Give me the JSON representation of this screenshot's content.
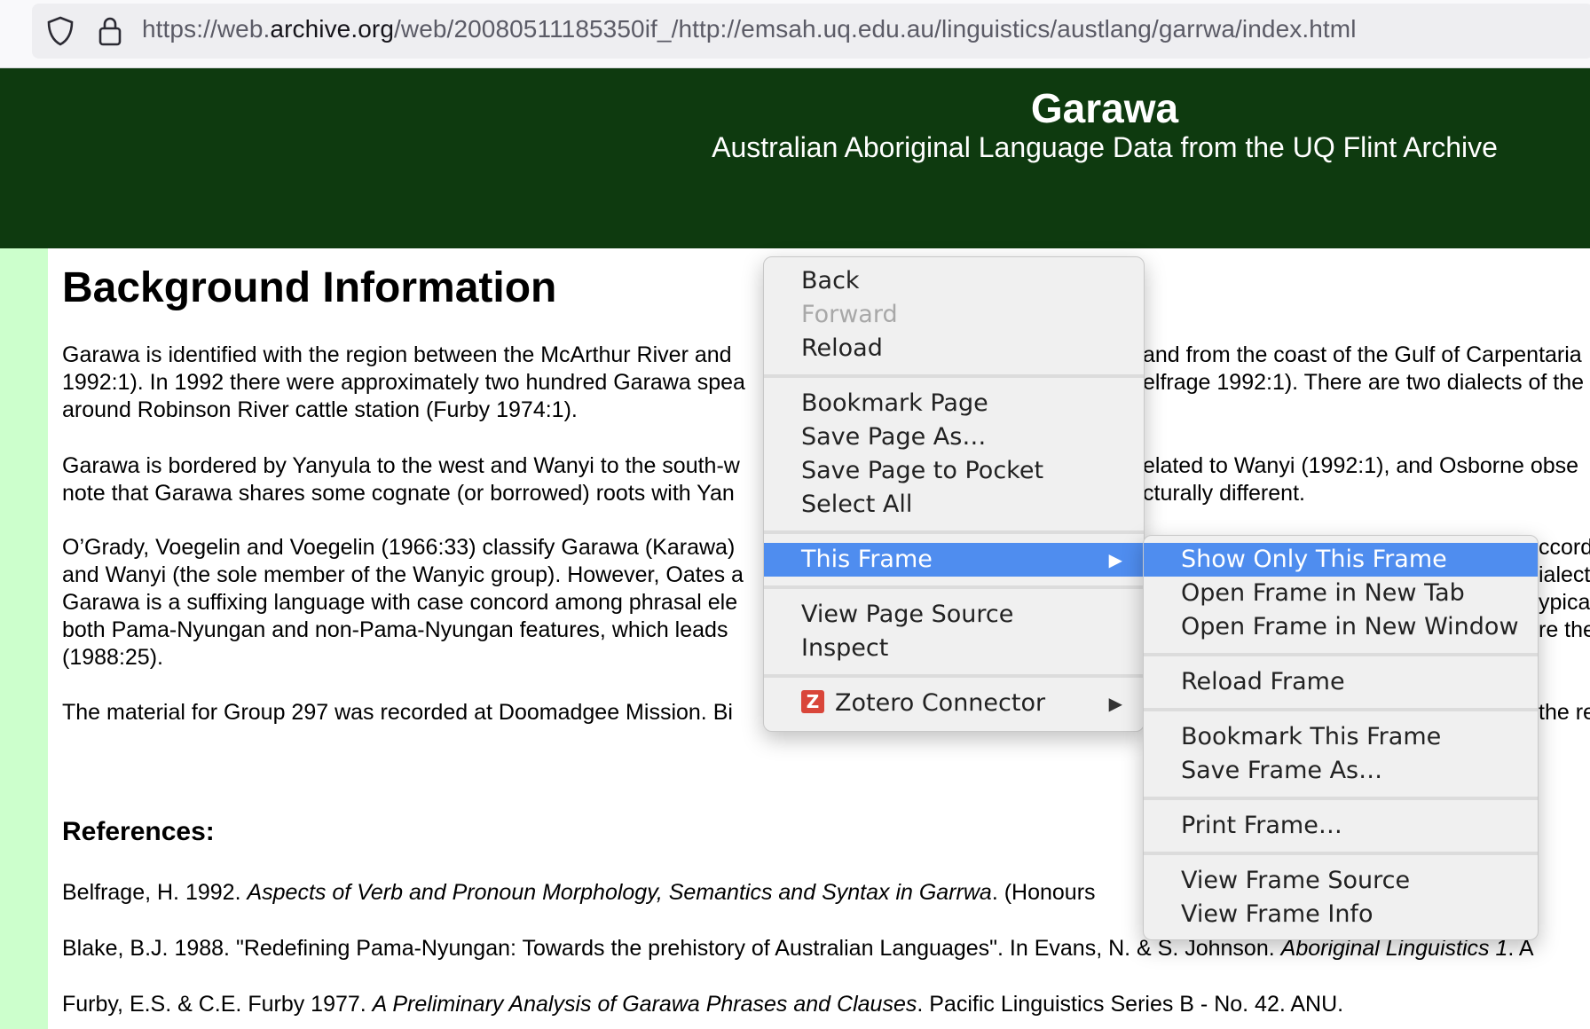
{
  "browser": {
    "url_prefix": "https://web.",
    "url_domain": "archive.org",
    "url_rest": "/web/20080511185350if_/http://emsah.uq.edu.au/linguistics/austlang/garrwa/index.html",
    "icons": [
      "shield-icon",
      "lock-icon"
    ]
  },
  "banner": {
    "title": "Garawa",
    "subtitle": "Australian Aboriginal Language Data from the UQ Flint Archive"
  },
  "colors": {
    "banner": "#0e3a0f",
    "stripe": "#ccffcc",
    "menu_highlight": "#4f8def"
  },
  "content": {
    "heading": "Background Information",
    "paragraphs": [
      [
        "Garawa is identified with the region between the McArthur River and ",
        "1992:1). In 1992 there were approximately two hundred Garawa spea",
        "around Robinson River cattle station (Furby 1974:1)."
      ],
      [
        "Garawa is bordered by Yanyula to the west and Wanyi to the south-w",
        "note that Garawa shares some cognate (or borrowed) roots with Yan"
      ],
      [
        "O’Grady, Voegelin and Voegelin (1966:33) classify Garawa (Karawa)",
        "and Wanyi (the sole member of the Wanyic group). However, Oates a",
        "Garawa is a suffixing language with case concord among phrasal ele",
        "both Pama-Nyungan and non-Pama-Nyungan features, which leads",
        "(1988:25)."
      ],
      [
        "The material for Group 297 was recorded at Doomadgee Mission. Bi"
      ]
    ],
    "right_fragments": [
      "and from the coast of the Gulf of Carpentaria",
      "elfrage 1992:1). There are two dialects of the",
      "elated to Wanyi (1992:1), and Osborne obse",
      "cturally different."
    ],
    "right_frag2": [
      "ccordi",
      "ialect c",
      "ypical",
      "re the",
      "the re"
    ],
    "references_title": "References:",
    "references": [
      {
        "pre": "Belfrage, H. 1992. ",
        "italic": "Aspects of Verb and Pronoun Morphology, Semantics and Syntax in Garrwa",
        "post": ". (Honours"
      },
      {
        "pre": "Blake, B.J. 1988. \"Redefining Pama-Nyungan: Towards the prehistory of Australian Languages\". In Evans, N. & S. Johnson. ",
        "italic": "Aboriginal Linguistics 1",
        "post": ". A"
      },
      {
        "pre": "Furby, E.S. & C.E. Furby 1977. ",
        "italic": "A Preliminary Analysis of Garawa Phrases and Clauses",
        "post": ". Pacific Linguistics Series B - No. 42. ANU."
      }
    ]
  },
  "context_menu": {
    "back": "Back",
    "forward": "Forward",
    "reload": "Reload",
    "bookmark_page": "Bookmark Page",
    "save_page_as": "Save Page As…",
    "save_to_pocket": "Save Page to Pocket",
    "select_all": "Select All",
    "this_frame": "This Frame",
    "view_page_source": "View Page Source",
    "inspect": "Inspect",
    "zotero": "Zotero Connector",
    "zotero_icon_letter": "Z"
  },
  "submenu": {
    "show_only": "Show Only This Frame",
    "open_tab": "Open Frame in New Tab",
    "open_window": "Open Frame in New Window",
    "reload_frame": "Reload Frame",
    "bookmark_frame": "Bookmark This Frame",
    "save_frame": "Save Frame As…",
    "print_frame": "Print Frame…",
    "view_frame_source": "View Frame Source",
    "view_frame_info": "View Frame Info",
    "arrow": "▶"
  }
}
